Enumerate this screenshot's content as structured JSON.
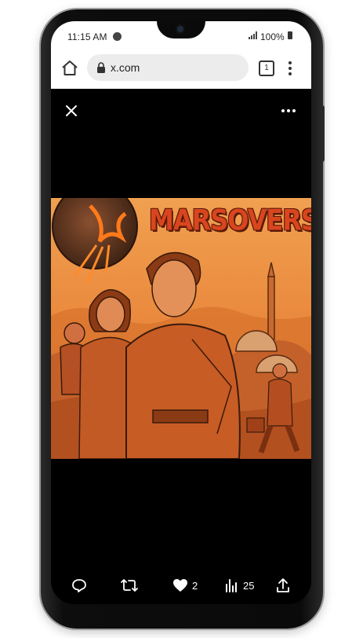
{
  "status_bar": {
    "time": "11:15 AM",
    "battery": "100%"
  },
  "browser": {
    "url": "x.com",
    "tab_count": "1"
  },
  "media": {
    "poster_title": "MARSOVERSE"
  },
  "actions": {
    "likes": "2",
    "views": "25"
  },
  "icons": {
    "home": "home-icon",
    "lock": "lock-icon",
    "tabs": "tab-switcher-icon",
    "menu": "more-vertical-icon",
    "close": "close-icon",
    "more": "more-horizontal-icon",
    "reply": "reply-icon",
    "repost": "repost-icon",
    "like": "heart-icon",
    "views": "views-icon",
    "share": "share-icon"
  },
  "colors": {
    "viewer_background": "#000000",
    "poster_accent": "#d9451f"
  }
}
